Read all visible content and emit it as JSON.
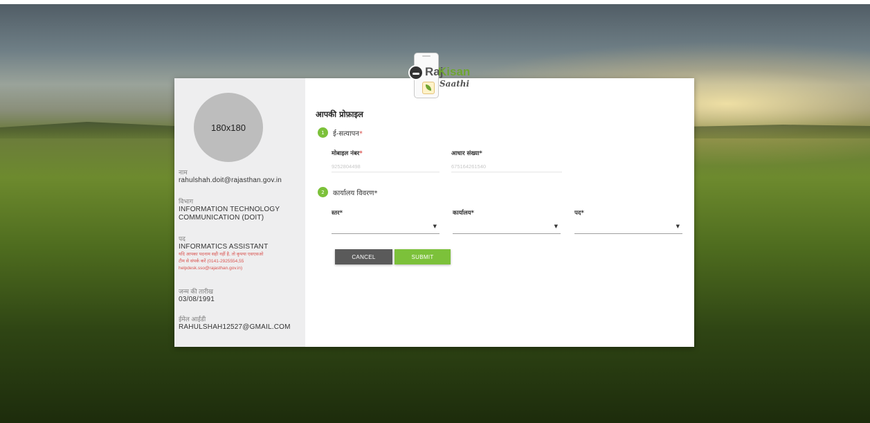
{
  "brand": {
    "part1": "Raj",
    "part2": "Kisan",
    "part3": "Saathi"
  },
  "profile": {
    "avatar_text": "180x180",
    "name_label": "नाम",
    "name_value": "rahulshah.doit@rajasthan.gov.in",
    "dept_label": "विभाग",
    "dept_value_line1": "INFORMATION TECHNOLOGY",
    "dept_value_line2": "COMMUNICATION (DOIT)",
    "post_label": "पद",
    "post_value": "INFORMATICS ASSISTANT",
    "warning_line1": "यदि आपका पदनाम सही नहीं है, तो कृपया एसएसओ",
    "warning_line2": "टीम से संपर्क करें (0141-2925554,55",
    "warning_line3": "helpdesk.sso@rajasthan.gov.in)",
    "dob_label": "जन्म की तारीख",
    "dob_value": "03/08/1991",
    "email_label": "ईमेल आईडी",
    "email_value": "RAHULSHAH12527@GMAIL.COM"
  },
  "form": {
    "title": "आपकी प्रोफ़ाइल",
    "step1": {
      "number": "1",
      "label": "ई-सत्यापन",
      "required_mark": "*",
      "mobile_label": "मोबाइल नंबर",
      "mobile_required": "*",
      "mobile_value": "9252804498",
      "aadhaar_label": "आधार संख्या*",
      "aadhaar_value": "675164261540"
    },
    "step2": {
      "number": "2",
      "label": "कार्यालय विवरण*",
      "level_label": "स्तर*",
      "office_label": "कार्यालय*",
      "post_label": "पद*",
      "caret": "▼"
    },
    "cancel_label": "CANCEL",
    "submit_label": "SUBMIT"
  },
  "colors": {
    "accent_green": "#7cc13a",
    "cancel_gray": "#5a5a5a",
    "required_red": "#d9534f"
  }
}
